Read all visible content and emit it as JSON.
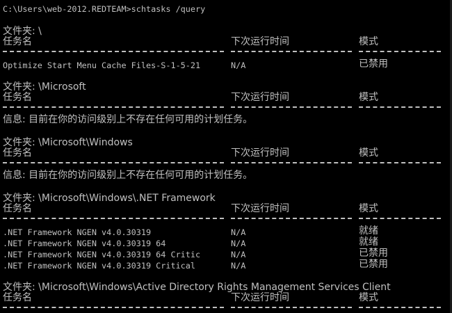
{
  "window": {
    "colors": {
      "background": "#000000",
      "text": "#c0c0c0"
    }
  },
  "prompt": {
    "command_line": "C:\\Users\\web-2012.REDTEAM>schtasks /query"
  },
  "headers": {
    "task_name": "任务名",
    "next_run_time": "下次运行时间",
    "mode": "模式"
  },
  "folders": [
    {
      "label": "文件夹: \\",
      "rows": [
        {
          "name": "Optimize Start Menu Cache Files-S-1-5-21",
          "next": "N/A",
          "mode": "已禁用"
        }
      ]
    },
    {
      "label": "文件夹: \\Microsoft",
      "info": "信息: 目前在你的访问级别上不存在任何可用的计划任务。"
    },
    {
      "label": "文件夹: \\Microsoft\\Windows",
      "info": "信息: 目前在你的访问级别上不存在任何可用的计划任务。"
    },
    {
      "label": "文件夹: \\Microsoft\\Windows\\.NET Framework",
      "rows": [
        {
          "name": ".NET Framework NGEN v4.0.30319",
          "next": "N/A",
          "mode": "就绪"
        },
        {
          "name": ".NET Framework NGEN v4.0.30319 64",
          "next": "N/A",
          "mode": "就绪"
        },
        {
          "name": ".NET Framework NGEN v4.0.30319 64 Critic",
          "next": "N/A",
          "mode": "已禁用"
        },
        {
          "name": ".NET Framework NGEN v4.0.30319 Critical",
          "next": "N/A",
          "mode": "已禁用"
        }
      ]
    },
    {
      "label": "文件夹: \\Microsoft\\Windows\\Active Directory Rights Management Services Client"
    }
  ]
}
